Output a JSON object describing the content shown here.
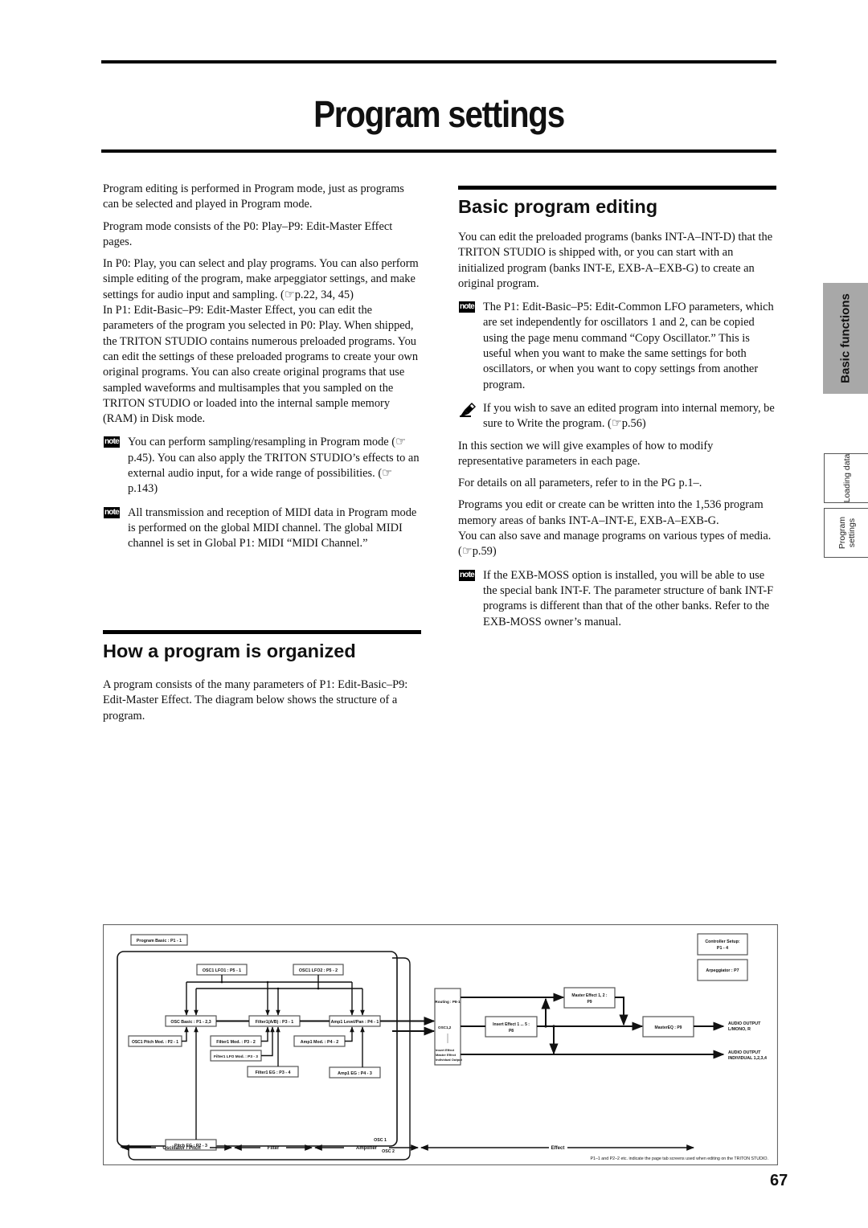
{
  "page": {
    "title": "Program settings",
    "page_number": "67"
  },
  "left_column": {
    "paragraphs": [
      "Program editing is performed in Program mode, just as programs can be selected and played in Program mode.",
      "Program mode consists of the P0: Play–P9: Edit-Master Effect pages.",
      "In P0: Play, you can select and play programs. You can also perform simple editing of the program, make arpeggiator settings, and make settings for audio input and sampling. (☞p.22, 34, 45)",
      "In P1: Edit-Basic–P9: Edit-Master Effect, you can edit the parameters of the program you selected in P0: Play. When shipped, the TRITON STUDIO contains numerous preloaded programs. You can edit the settings of these preloaded programs to create your own original programs. You can also create original programs that use sampled waveforms and multisamples that you sampled on the TRITON STUDIO or loaded into the internal sample memory (RAM) in Disk mode."
    ],
    "notes": [
      "You can perform sampling/resampling in Program mode (☞p.45). You can also apply the TRITON STUDIO’s effects to an external audio input, for a wide range of possibilities. (☞p.143)",
      "All transmission and reception of MIDI data in Program mode is performed on the global MIDI channel. The global MIDI channel is set in Global P1: MIDI “MIDI Channel.”"
    ],
    "section": {
      "heading": "How a program is organized",
      "paragraph": "A program consists of the many parameters of P1: Edit-Basic–P9: Edit-Master Effect. The diagram below shows the structure of a program."
    }
  },
  "right_column": {
    "heading": "Basic program editing",
    "intro": "You can edit the preloaded programs (banks INT-A–INT-D) that the TRITON STUDIO is shipped with, or you can start with an initialized program (banks INT-E, EXB-A–EXB-G) to create an original program.",
    "note1": "The P1: Edit-Basic–P5: Edit-Common LFO parameters, which are set independently for oscillators 1 and 2, can be copied using the page menu command “Copy Oscillator.” This is useful when you want to make the same settings for both oscillators, or when you want to copy settings from another program.",
    "caution": "If you wish to save an edited program into internal memory, be sure to Write the program. (☞p.56)",
    "paragraphs": [
      "In this section we will give examples of how to modify representative parameters in each page.",
      "For details on all parameters, refer to in the PG p.1–.",
      "Programs you edit or create can be written into the 1,536 program memory areas of banks INT-A–INT-E, EXB-A–EXB-G.",
      "You can also save and manage programs on various types of media. (☞p.59)"
    ],
    "note2": "If the EXB-MOSS option is installed, you will be able to use the special bank INT-F. The parameter structure of bank INT-F programs is different than that of the other banks. Refer to the EXB-MOSS owner’s manual."
  },
  "icons": {
    "note_label": "note",
    "note_icon": "note-badge-icon",
    "caution_icon": "pencil-caution-icon",
    "reference_icon": "pointing-hand-icon"
  },
  "side_tabs": {
    "main": "Basic functions",
    "loading": "Loading data",
    "program_line1": "Program",
    "program_line2": "settings"
  },
  "diagram": {
    "blocks": {
      "program_basic": "Program Basic : P1 - 1",
      "controller_setup_1": "Controller Setup:",
      "controller_setup_2": "P1 - 4",
      "arpeggiator": "Arpeggiator : P7",
      "osc1_lfo1": "OSC1 LFO1 : P5 - 1",
      "osc1_lfo2": "OSC1 LFO2 : P5 - 2",
      "osc_basic": "OSC Basic : P1 - 2,3",
      "filter1": "Filter1(A/B) : P3 - 1",
      "amp1_level": "Amp1 Level/Pan : P4 - 1",
      "osc1_pitch_mod": "OSC1 Pitch Mod. : P2 - 1",
      "filter1_mod": "Filter1 Mod. : P3 - 2",
      "filter1_lfo_mod": "Filter1 LFO Mod. : P3 - 3",
      "filter1_eg": "Filter1 EG : P3 - 4",
      "amp1_mod": "Amp1 Mod. : P4 - 2",
      "amp1_eg": "Amp1 EG : P4 - 3",
      "pitch_eg": "Pitch EG : P2 - 3",
      "osc1_label": "OSC 1",
      "osc2_label": "OSC 2",
      "routing": "Routing : P8-1",
      "routing_osc": "OSC1,2",
      "routing_insert": "Insert Effect",
      "routing_master": "Master Effect",
      "routing_individual": "Individual Output",
      "insert_effect_1": "Insert Effect 1 ... 5 :",
      "insert_effect_2": "P8",
      "master_effect_1": "Master Effect 1, 2 :",
      "master_effect_2": "P9",
      "master_eq": "MasterEQ : P9",
      "audio_out_main_1": "AUDIO OUTPUT",
      "audio_out_main_2": "L/MONO, R",
      "audio_out_ind_1": "AUDIO OUTPUT",
      "audio_out_ind_2": "INDIVIDUAL 1,2,3,4"
    },
    "stages": [
      "Oscillator / Pitch",
      "Filter",
      "Amplifier",
      "Effect"
    ],
    "footnote": "P1–1 and P2–2 etc. indicate the page tab screens used when editing on the TRITON STUDIO."
  }
}
